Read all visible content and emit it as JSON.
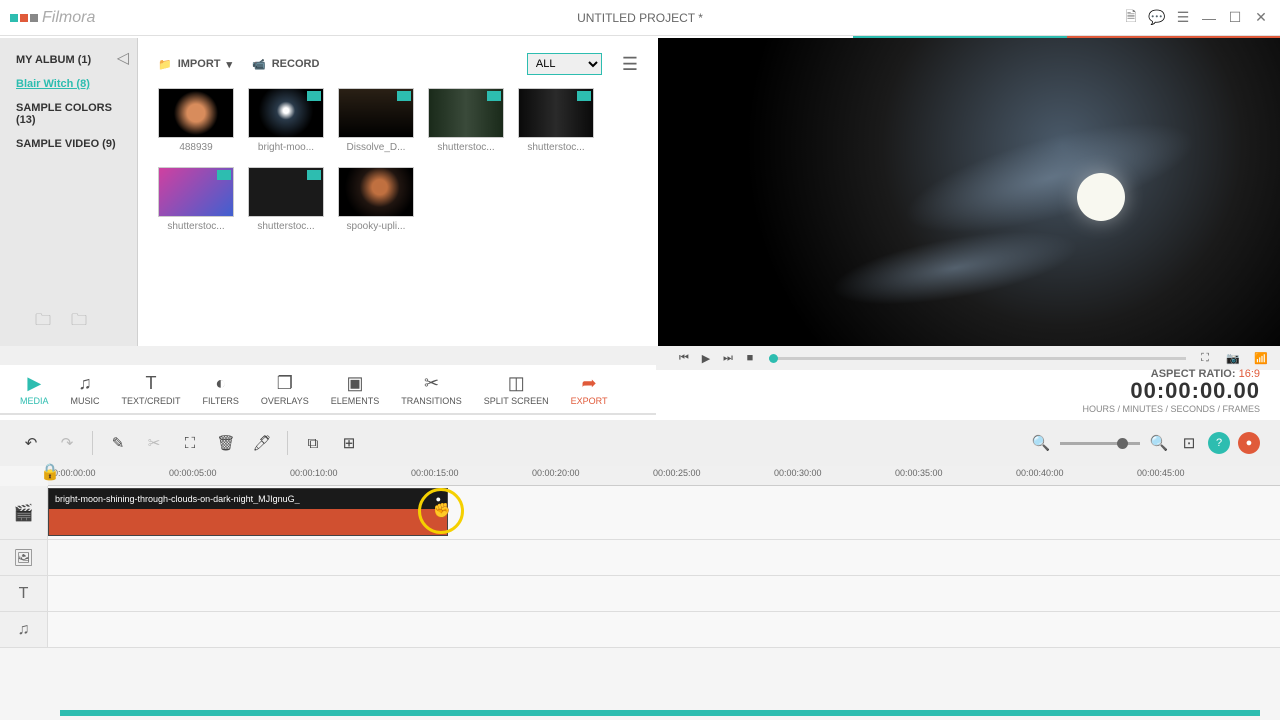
{
  "titlebar": {
    "logo_text": "Filmora",
    "project_title": "UNTITLED PROJECT *"
  },
  "sidebar": {
    "items": [
      {
        "label": "MY ALBUM (1)"
      },
      {
        "label": "Blair Witch (8)"
      },
      {
        "label": "SAMPLE COLORS (13)"
      },
      {
        "label": "SAMPLE VIDEO (9)"
      }
    ]
  },
  "media_toolbar": {
    "import_label": "IMPORT",
    "record_label": "RECORD",
    "filter_value": "ALL"
  },
  "media_items": [
    {
      "label": "488939"
    },
    {
      "label": "bright-moo..."
    },
    {
      "label": "Dissolve_D..."
    },
    {
      "label": "shutterstoc..."
    },
    {
      "label": "shutterstoc..."
    },
    {
      "label": "shutterstoc..."
    },
    {
      "label": "shutterstoc..."
    },
    {
      "label": "spooky-upli..."
    }
  ],
  "tabs": [
    {
      "label": "MEDIA",
      "icon": "▶"
    },
    {
      "label": "MUSIC",
      "icon": "♫"
    },
    {
      "label": "TEXT/CREDIT",
      "icon": "T"
    },
    {
      "label": "FILTERS",
      "icon": "◐"
    },
    {
      "label": "OVERLAYS",
      "icon": "❐"
    },
    {
      "label": "ELEMENTS",
      "icon": "▣"
    },
    {
      "label": "TRANSITIONS",
      "icon": "✂"
    },
    {
      "label": "SPLIT SCREEN",
      "icon": "◫"
    },
    {
      "label": "EXPORT",
      "icon": "➦"
    }
  ],
  "info": {
    "ratio_label": "ASPECT RATIO:",
    "ratio_value": "16:9",
    "timecode": "00:00:00.00",
    "timecode_label": "HOURS / MINUTES / SECONDS / FRAMES"
  },
  "ruler_marks": [
    "00:00:00:00",
    "00:00:05:00",
    "00:00:10:00",
    "00:00:15:00",
    "00:00:20:00",
    "00:00:25:00",
    "00:00:30:00",
    "00:00:35:00",
    "00:00:40:00",
    "00:00:45:00"
  ],
  "clip": {
    "label": "bright-moon-shining-through-clouds-on-dark-night_MJIgnuG_"
  }
}
